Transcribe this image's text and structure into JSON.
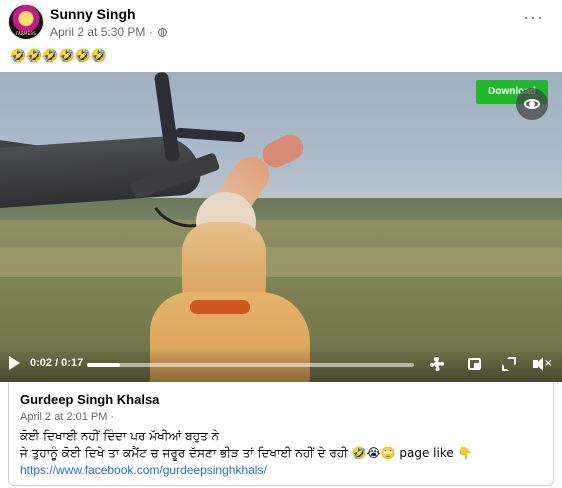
{
  "post": {
    "author": "Sunny Singh",
    "meta": "April 2 at 5:30 PM ·",
    "caption": "🤣🤣🤣🤣🤣🤣",
    "avatar_text": "FARMERS"
  },
  "video": {
    "download_label": "Download",
    "time": "0:02 / 0:17",
    "progress_fraction": 0.1
  },
  "shared": {
    "author": "Gurdeep Singh Khalsa",
    "meta": "April 2 at 2:01 PM ·",
    "line1": "ਕੋਈ ਦਿਖਾਈ ਨਹੀਂ ਦਿੰਦਾ ਪਰ ਮੱਖੀਆਂ ਬਹੁਤ ਨੇ",
    "line2": "ਜੇ ਤੁਹਾਨੂੰ ਕੋਈ ਦਿਖੇ ਤਾ ਕਮੈਂਟ ਚ ਜਰੂਰ ਦੱਸਣਾ ਭੀੜ ਤਾਂ ਦਿਖਾਈ ਨਹੀਂ ਦੇ ਰਹੀ 🤣😭🙄 page like 👇",
    "link": "https://www.facebook.com/gurdeepsinghkhals/"
  },
  "colors": {
    "download_green": "#1fb829",
    "link_blue": "#216fdb",
    "meta_gray": "#65676b"
  },
  "icons": [
    "globe-icon",
    "more-icon",
    "eye-icon",
    "play-icon",
    "gear-icon",
    "pip-icon",
    "fullscreen-icon",
    "mute-icon"
  ]
}
